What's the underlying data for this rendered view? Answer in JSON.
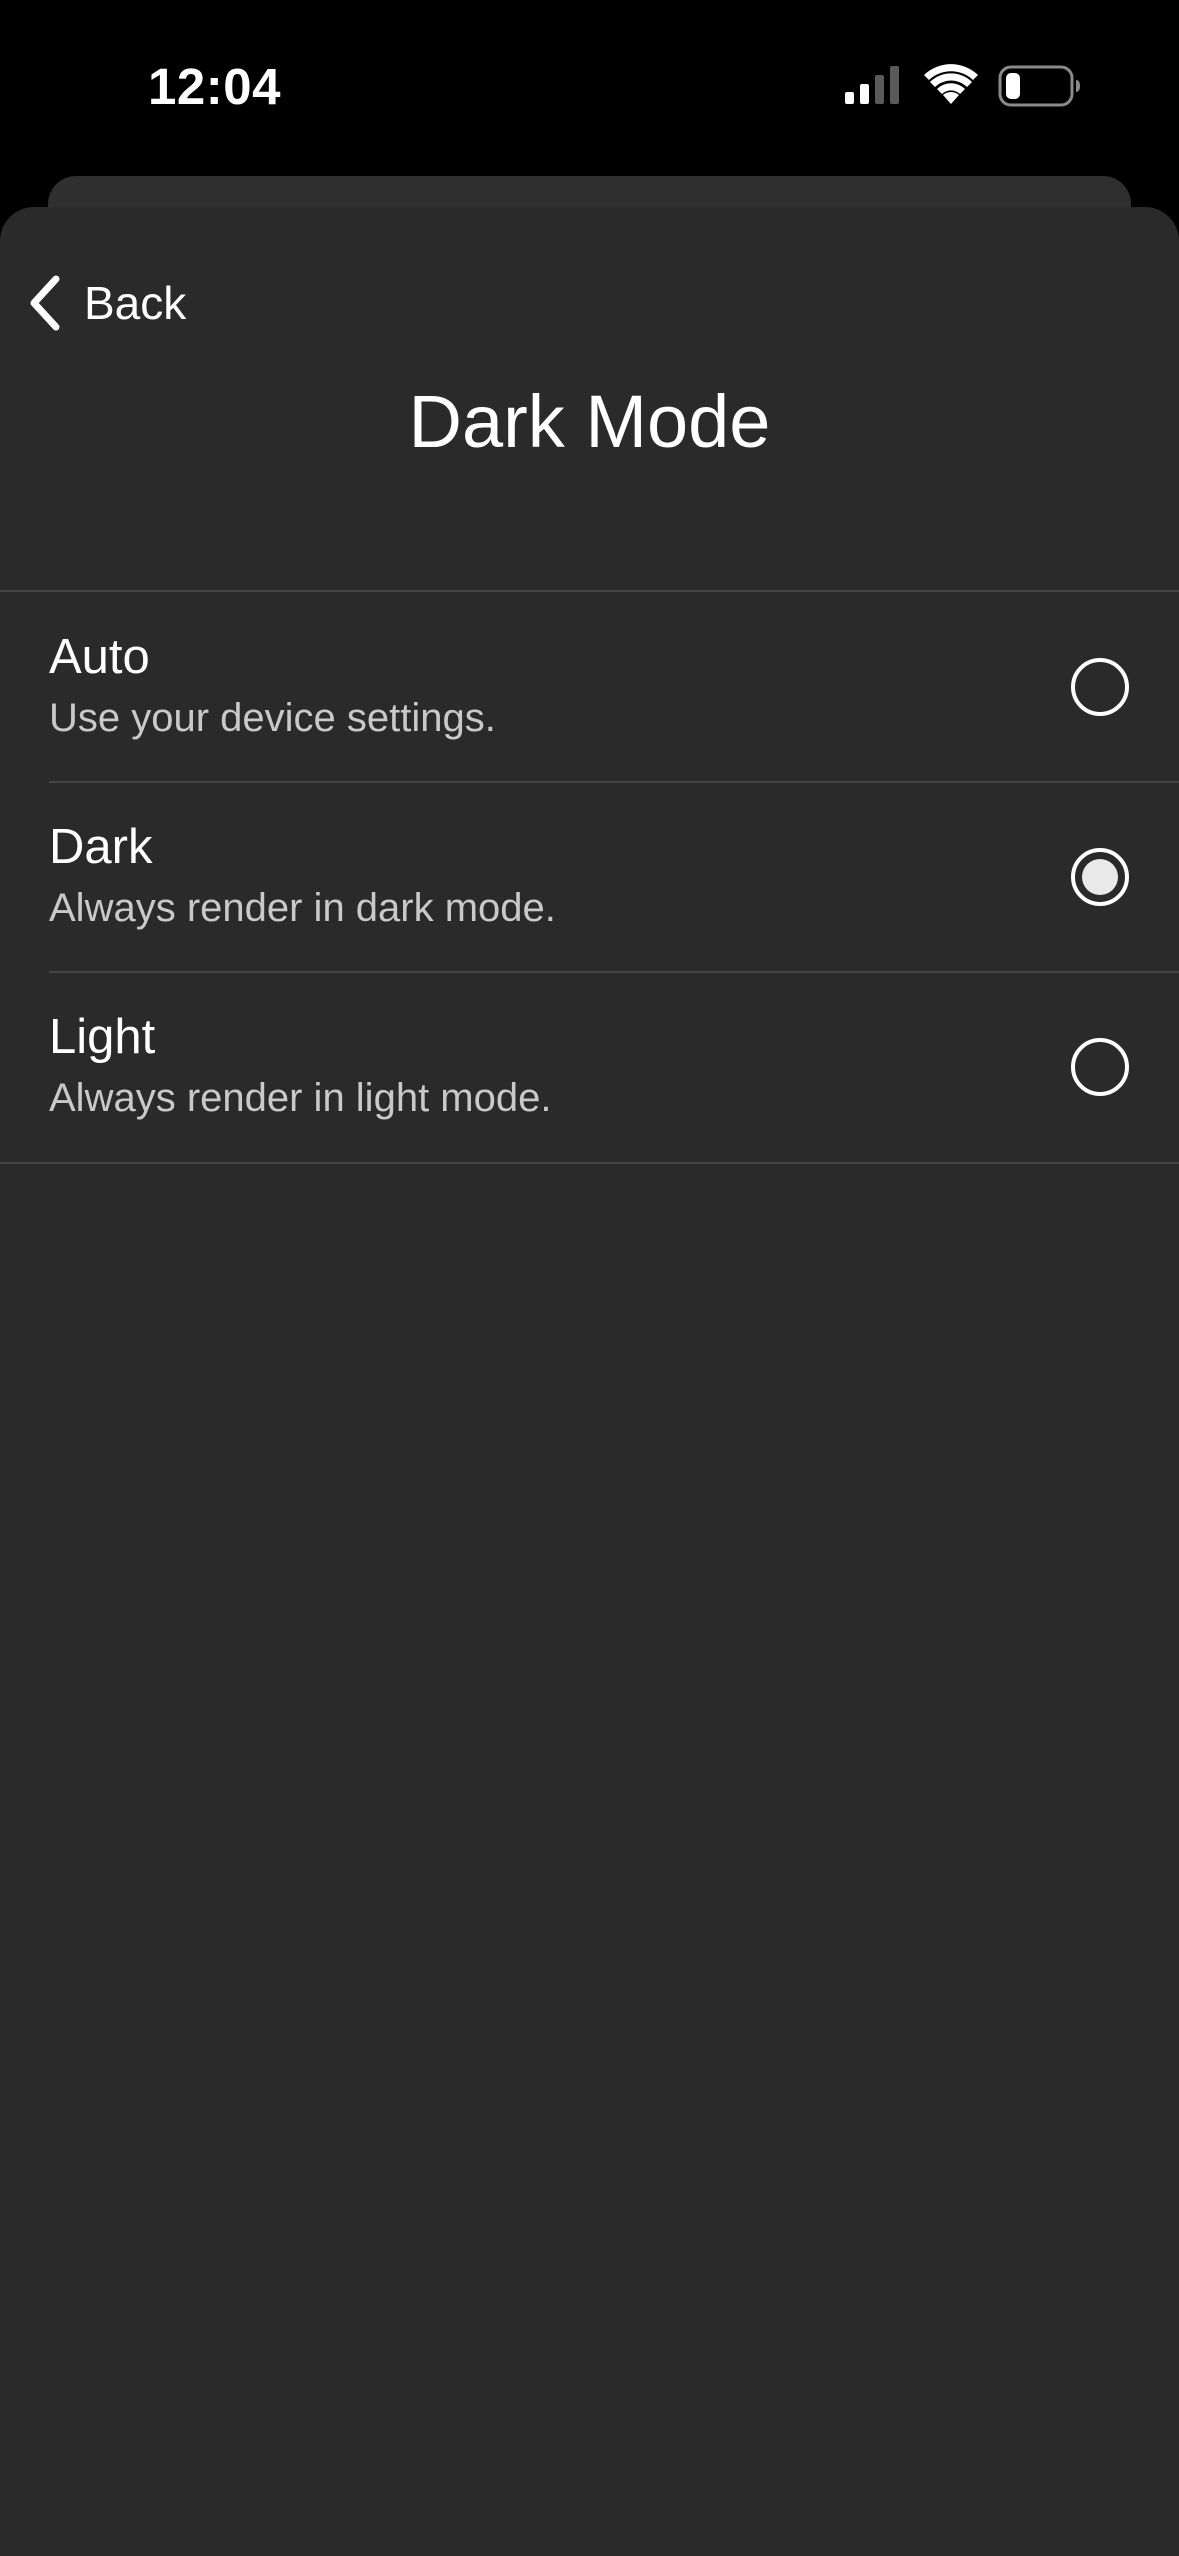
{
  "status_bar": {
    "time": "12:04"
  },
  "nav": {
    "back_label": "Back",
    "title": "Dark Mode"
  },
  "options": [
    {
      "title": "Auto",
      "description": "Use your device settings.",
      "selected": false
    },
    {
      "title": "Dark",
      "description": "Always render in dark mode.",
      "selected": true
    },
    {
      "title": "Light",
      "description": "Always render in light mode.",
      "selected": false
    }
  ],
  "colors": {
    "background": "#000000",
    "sheet": "#2a2a2a",
    "text_primary": "#ffffff",
    "text_secondary": "#c9c9c9",
    "divider": "#444444"
  },
  "icons": {
    "signal": "cellular-signal-icon",
    "wifi": "wifi-icon",
    "battery": "battery-low-icon",
    "back": "chevron-left-icon",
    "radio_off": "radio-unselected-icon",
    "radio_on": "radio-selected-icon"
  }
}
